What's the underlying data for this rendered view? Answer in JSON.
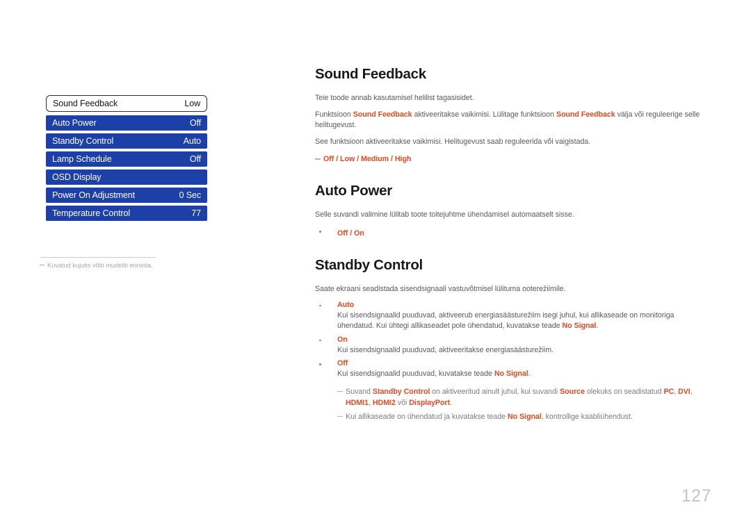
{
  "osd_menu": {
    "rows": [
      {
        "label": "Sound Feedback",
        "value": "Low",
        "state": "selected"
      },
      {
        "label": "Auto Power",
        "value": "Off",
        "state": "normal"
      },
      {
        "label": "Standby Control",
        "value": "Auto",
        "state": "normal"
      },
      {
        "label": "Lamp Schedule",
        "value": "Off",
        "state": "normal"
      },
      {
        "label": "OSD Display",
        "value": "",
        "state": "normal"
      },
      {
        "label": "Power On Adjustment",
        "value": "0 Sec",
        "state": "normal"
      },
      {
        "label": "Temperature Control",
        "value": "77",
        "state": "normal"
      }
    ],
    "footnote": "Kuvatud kujutis võib mudeliti erineda."
  },
  "sections": {
    "sound_feedback": {
      "title": "Sound Feedback",
      "p1": "Teie toode annab kasutamisel helilist tagasisidet.",
      "p2_a": "Funktsioon ",
      "p2_hl1": "Sound Feedback",
      "p2_b": " aktiveeritakse vaikimisi. Lülitage funktsioon ",
      "p2_hl2": "Sound Feedback",
      "p2_c": " välja või reguleerige selle helitugevust.",
      "p3": "See funktsioon aktiveeritakse vaikimisi. Helitugevust saab reguleerida või vaigistada.",
      "options_note": "Off / Low / Medium / High"
    },
    "auto_power": {
      "title": "Auto Power",
      "p1": "Selle suvandi valimine lülitab toote toitejuhtme ühendamisel automaatselt sisse.",
      "options": "Off / On"
    },
    "standby_control": {
      "title": "Standby Control",
      "p1": "Saate ekraani seadistada sisendsignaali vastuvõtmisel lülituma ooterežiimile.",
      "items": [
        {
          "option": "Auto",
          "desc_a": "Kui sisendsignaalid puuduvad, aktiveerub energiasäästurežiim isegi juhul, kui allikaseade on monitoriga ühendatud. Kui ühtegi allikaseadet pole ühendatud, kuvatakse teade ",
          "desc_hl": "No Signal",
          "desc_b": "."
        },
        {
          "option": "On",
          "desc_a": "Kui sisendsignaalid puuduvad, aktiveeritakse energiasäästurežiim.",
          "desc_hl": "",
          "desc_b": ""
        },
        {
          "option": "Off",
          "desc_a": "Kui sisendsignaalid puuduvad, kuvatakse teade ",
          "desc_hl": "No Signal",
          "desc_b": "."
        }
      ],
      "note1_a": "Suvand ",
      "note1_hl1": "Standby Control",
      "note1_b": " on aktiveeritud ainult juhul, kui suvandi ",
      "note1_hl2": "Source",
      "note1_c": " olekuks on seadistatud ",
      "note1_hl3": "PC",
      "note1_d": ", ",
      "note1_hl4": "DVI",
      "note1_e": ", ",
      "note1_hl5": "HDMI1",
      "note1_f": ", ",
      "note1_hl6": "HDMI2",
      "note1_g": " või ",
      "note1_hl7": "DisplayPort",
      "note1_h": ".",
      "note2_a": "Kui allikaseade on ühendatud ja kuvatakse teade ",
      "note2_hl": "No Signal",
      "note2_b": ", kontrollige kaabliühendust."
    }
  },
  "footer": {
    "page_number": "127"
  },
  "colors": {
    "menu_blue": "#1c3fa8",
    "accent_orange": "#e8491e",
    "body_gray": "#5a5b5e",
    "page_number_gray": "#c3c4c8"
  }
}
